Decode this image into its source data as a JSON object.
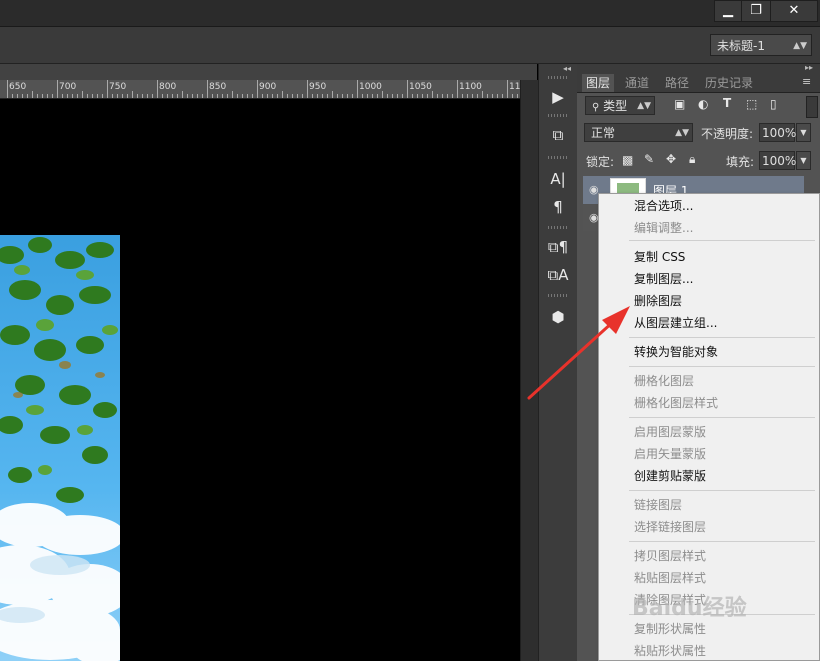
{
  "window": {
    "minimize_glyph": "▁",
    "restore_glyph": "❐",
    "close_glyph": "✕"
  },
  "options_bar": {
    "document_select": "未标题-1"
  },
  "ruler": {
    "labels": [
      "650",
      "700",
      "750",
      "800",
      "850",
      "900",
      "950",
      "1000",
      "1050",
      "1100",
      "11"
    ]
  },
  "tools_strip": {
    "collapse_glyph": "◂◂"
  },
  "layers_panel": {
    "expand_glyph": "▸▸",
    "tabs": [
      "图层",
      "通道",
      "路径",
      "历史记录"
    ],
    "filter_kind": "类型",
    "blend_mode": "正常",
    "opacity_label": "不透明度:",
    "opacity_value": "100%",
    "lock_label": "锁定:",
    "fill_label": "填充:",
    "fill_value": "100%",
    "layer_name": "图层 1"
  },
  "context_menu": {
    "items": [
      {
        "label": "混合选项...",
        "enabled": true
      },
      {
        "label": "编辑调整...",
        "enabled": false
      },
      {
        "label": "复制 CSS",
        "enabled": true
      },
      {
        "label": "复制图层...",
        "enabled": true
      },
      {
        "label": "删除图层",
        "enabled": true
      },
      {
        "label": "从图层建立组...",
        "enabled": true
      },
      {
        "label": "转换为智能对象",
        "enabled": true
      },
      {
        "label": "栅格化图层",
        "enabled": false
      },
      {
        "label": "栅格化图层样式",
        "enabled": false
      },
      {
        "label": "启用图层蒙版",
        "enabled": false
      },
      {
        "label": "启用矢量蒙版",
        "enabled": false
      },
      {
        "label": "创建剪贴蒙版",
        "enabled": true
      },
      {
        "label": "链接图层",
        "enabled": false
      },
      {
        "label": "选择链接图层",
        "enabled": false
      },
      {
        "label": "拷贝图层样式",
        "enabled": false
      },
      {
        "label": "粘贴图层样式",
        "enabled": false
      },
      {
        "label": "清除图层样式",
        "enabled": false
      },
      {
        "label": "复制形状属性",
        "enabled": false
      },
      {
        "label": "粘贴形状属性",
        "enabled": false
      }
    ]
  },
  "watermark": "Baidu经验",
  "colors": {
    "annotation_arrow": "#e8322b",
    "selected_layer": "#6f7a8b",
    "menu_bg": "#f0f0f0"
  }
}
